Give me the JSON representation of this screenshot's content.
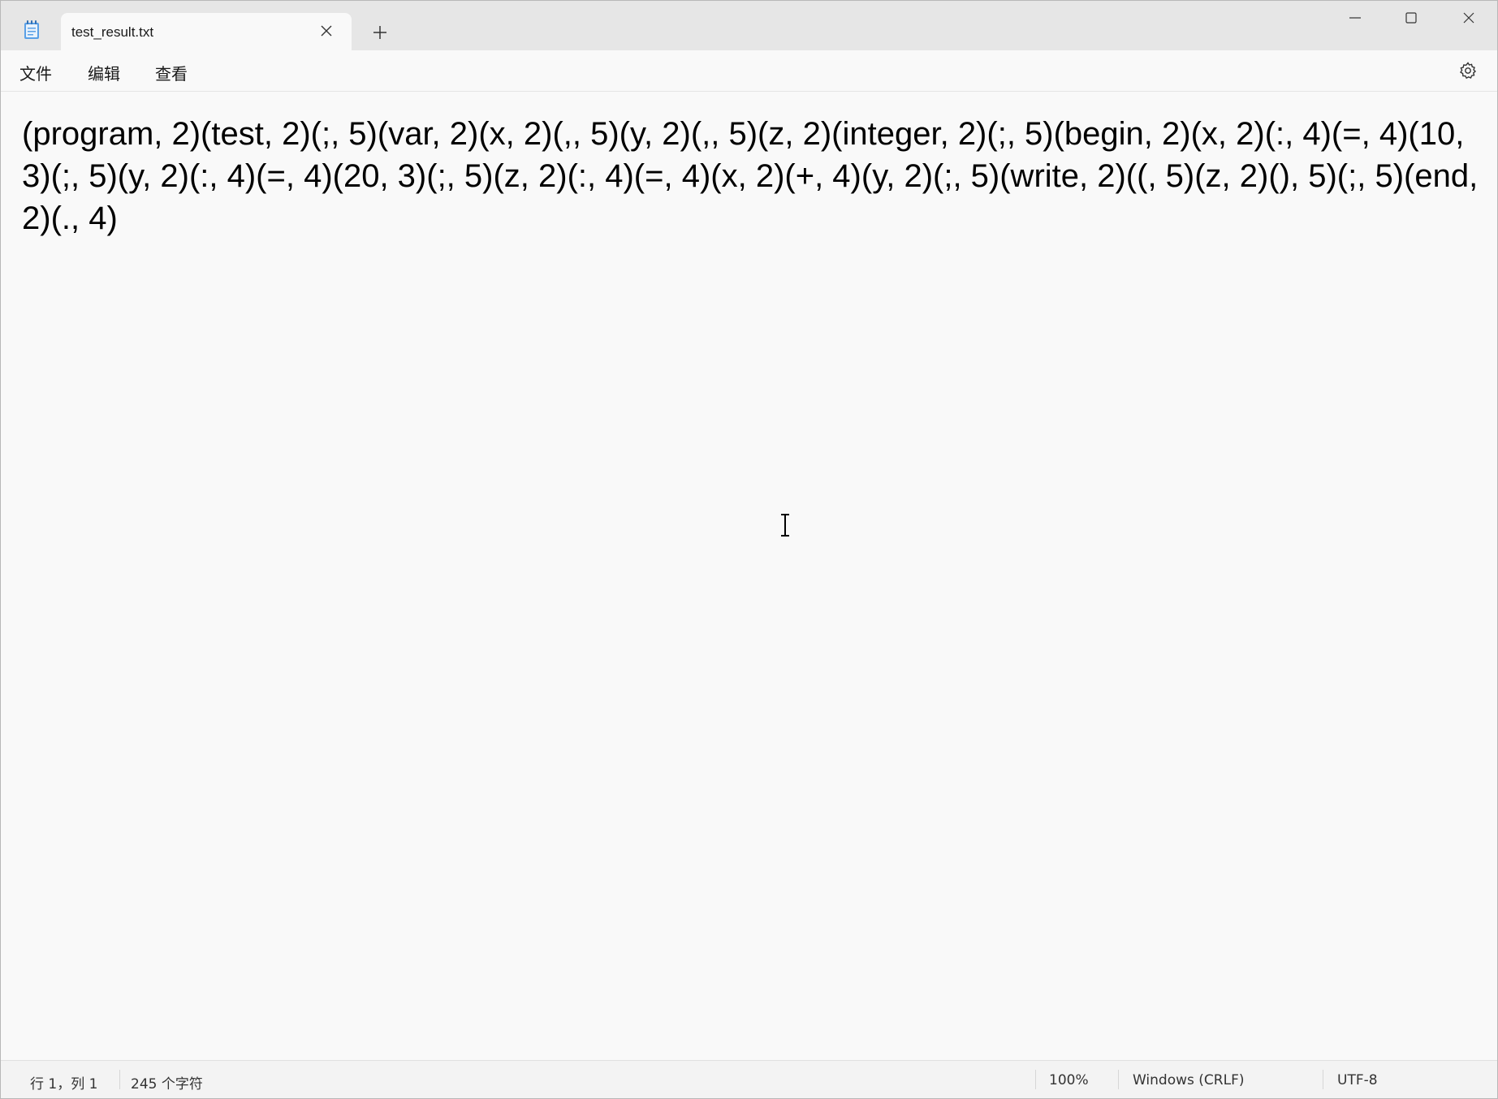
{
  "tab": {
    "title": "test_result.txt"
  },
  "menu": {
    "file": "文件",
    "edit": "编辑",
    "view": "查看"
  },
  "editor": {
    "content": "(program, 2)(test, 2)(;, 5)(var, 2)(x, 2)(,, 5)(y, 2)(,, 5)(z, 2)(integer, 2)(;, 5)(begin, 2)(x, 2)(:, 4)(=, 4)(10, 3)(;, 5)(y, 2)(:, 4)(=, 4)(20, 3)(;, 5)(z, 2)(:, 4)(=, 4)(x, 2)(+, 4)(y, 2)(;, 5)(write, 2)((, 5)(z, 2)(), 5)(;, 5)(end, 2)(., 4)"
  },
  "status": {
    "position": "行 1，列 1",
    "char_count": "245 个字符",
    "zoom": "100%",
    "line_ending": "Windows (CRLF)",
    "encoding": "UTF-8"
  },
  "icons": {
    "app": "notepad-icon",
    "close_tab": "close-icon",
    "new_tab": "plus-icon",
    "minimize": "minimize-icon",
    "maximize": "maximize-icon",
    "close_window": "close-icon",
    "settings": "gear-icon"
  },
  "colors": {
    "titlebar": "#e6e6e6",
    "editor_bg": "#f9f9f9",
    "accent": "#0067c0"
  }
}
